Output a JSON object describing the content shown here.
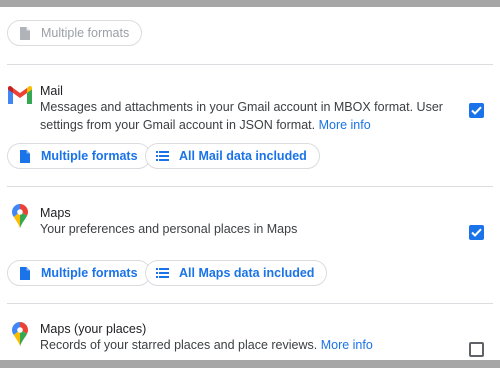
{
  "top_section": {
    "chip_label": "Multiple formats",
    "chip_icon": "file-icon"
  },
  "mail": {
    "title": "Mail",
    "description_line1": "Messages and attachments in your Gmail account in MBOX format. User",
    "description_line2": "settings from your Gmail account in JSON format.",
    "more_info": "More info",
    "checked": true,
    "format_chip": "Multiple formats",
    "data_chip": "All Mail data included"
  },
  "maps": {
    "title": "Maps",
    "description": "Your preferences and personal places in Maps",
    "checked": true,
    "format_chip": "Multiple formats",
    "data_chip": "All Maps data included"
  },
  "maps_places": {
    "title": "Maps (your places)",
    "description": "Records of your starred places and place reviews.",
    "more_info": "More info",
    "checked": false
  },
  "colors": {
    "accent": "#1a73e8",
    "divider": "#dadce0",
    "disabled": "#9aa0a6"
  }
}
